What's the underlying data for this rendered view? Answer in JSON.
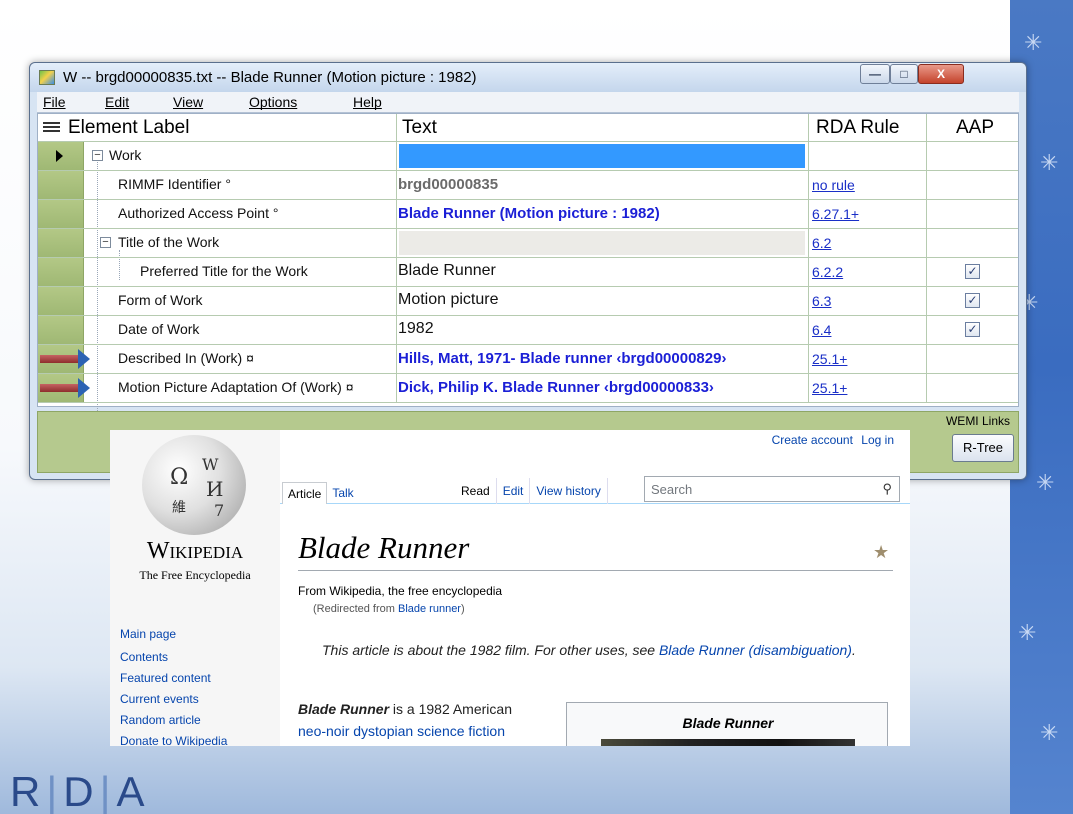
{
  "window": {
    "title": "W -- brgd00000835.txt -- Blade Runner (Motion picture : 1982)",
    "controls": {
      "minimize": "—",
      "maximize": "□",
      "close": "X"
    }
  },
  "menu": [
    "File",
    "Edit",
    "View",
    "Options",
    "Help"
  ],
  "grid": {
    "headers": {
      "label": "Element Label",
      "text": "Text",
      "rule": "RDA Rule",
      "aap": "AAP"
    },
    "rows": [
      {
        "label": "Work",
        "text": "",
        "rule": "",
        "aap": false
      },
      {
        "label": "RIMMF Identifier °",
        "text": "brgd00000835",
        "rule": "no rule",
        "aap": false
      },
      {
        "label": "Authorized Access Point °",
        "text": "Blade Runner (Motion picture : 1982)",
        "rule": "6.27.1+",
        "aap": false
      },
      {
        "label": "Title of the Work",
        "text": "",
        "rule": "6.2",
        "aap": false
      },
      {
        "label": "Preferred Title for the Work",
        "text": "Blade Runner",
        "rule": "6.2.2",
        "aap": true
      },
      {
        "label": "Form of Work",
        "text": "Motion picture",
        "rule": "6.3",
        "aap": true
      },
      {
        "label": "Date of Work",
        "text": "1982",
        "rule": "6.4",
        "aap": true
      },
      {
        "label": "Described In (Work) ¤",
        "text": "Hills, Matt, 1971- Blade runner ‹brgd00000829›",
        "rule": "25.1+",
        "aap": false
      },
      {
        "label": "Motion Picture Adaptation Of (Work) ¤",
        "text": "Dick, Philip K. Blade Runner ‹brgd00000833›",
        "rule": "25.1+",
        "aap": false
      }
    ]
  },
  "lower": {
    "wemi_label": "WEMI Links",
    "rtree_button": "R-Tree"
  },
  "wiki": {
    "account": {
      "create": "Create account",
      "login": "Log in"
    },
    "tabs_left": [
      "Article",
      "Talk"
    ],
    "tabs_right": [
      "Read",
      "Edit",
      "View history"
    ],
    "search_placeholder": "Search",
    "logo_word": "Wikipedia",
    "logo_tagline": "The Free Encyclopedia",
    "nav": [
      "Main page",
      "Contents",
      "Featured content",
      "Current events",
      "Random article",
      "Donate to Wikipedia"
    ],
    "title": "Blade Runner",
    "from": "From Wikipedia, the free encyclopedia",
    "redirect_prefix": "(Redirected from ",
    "redirect_link": "Blade runner",
    "redirect_suffix": ")",
    "hatnote_text": "This article is about the 1982 film. For other uses, see ",
    "hatnote_link": "Blade Runner (disambiguation)",
    "hatnote_end": ".",
    "lead_bold": "Blade Runner",
    "lead_text": " is a 1982 American",
    "lead_link": "neo-noir dystopian science fiction",
    "infobox_title": "Blade Runner"
  },
  "footer": {
    "logo": [
      "R",
      "D",
      "A"
    ]
  }
}
